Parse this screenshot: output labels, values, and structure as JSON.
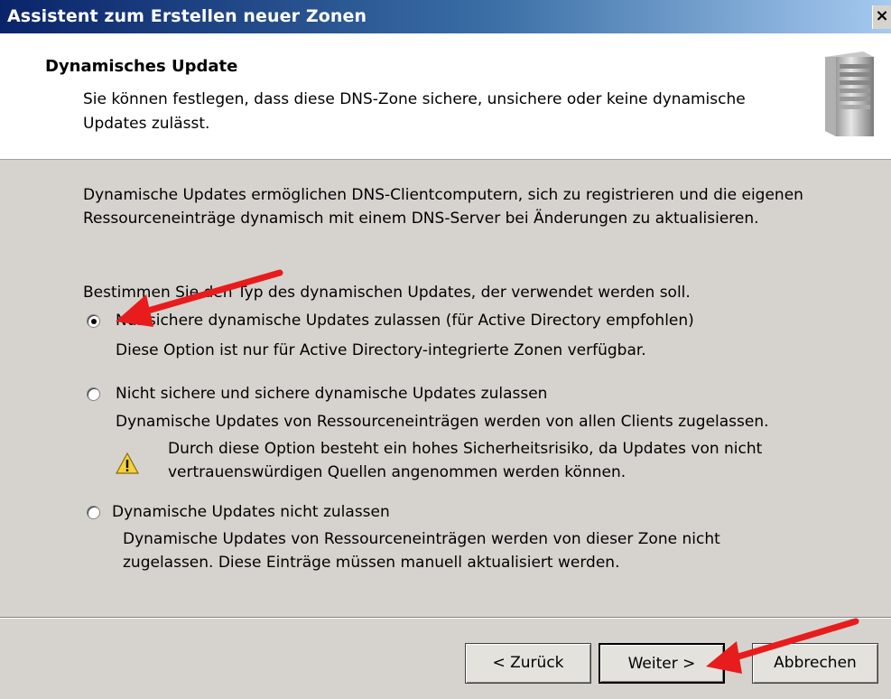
{
  "window": {
    "title": "Assistent zum Erstellen neuer Zonen",
    "close_label": "×"
  },
  "header": {
    "title": "Dynamisches Update",
    "description": "Sie können festlegen, dass diese DNS-Zone sichere, unsichere oder keine dynamische Updates zulässt.",
    "icon": "server-icon"
  },
  "body": {
    "intro": "Dynamische Updates ermöglichen DNS-Clientcomputern, sich zu registrieren und die eigenen Ressourceneinträge dynamisch mit einem DNS-Server bei Änderungen zu aktualisieren.",
    "prompt": "Bestimmen Sie den Typ des dynamischen Updates, der verwendet werden soll."
  },
  "options": [
    {
      "label": "Nur sichere dynamische Updates zulassen (für Active Directory empfohlen)",
      "description": "Diese Option ist nur für Active Directory-integrierte Zonen verfügbar.",
      "selected": true
    },
    {
      "label": "Nicht sichere und sichere dynamische Updates zulassen",
      "description": "Dynamische Updates von Ressourceneinträgen werden von allen Clients zugelassen.",
      "warning": "Durch diese Option besteht ein hohes Sicherheitsrisiko, da Updates von nicht vertrauenswürdigen Quellen angenommen werden können.",
      "selected": false
    },
    {
      "label": "Dynamische Updates nicht zulassen",
      "description": "Dynamische Updates von Ressourceneinträgen werden von dieser Zone nicht zugelassen. Diese Einträge müssen manuell aktualisiert werden.",
      "selected": false
    }
  ],
  "buttons": {
    "back": "< Zurück",
    "next": "Weiter >",
    "cancel": "Abbrechen"
  },
  "colors": {
    "annotation_arrow": "#e81c1c",
    "title_gradient_start": "#0a246a",
    "dialog_background": "#d6d3ce"
  }
}
